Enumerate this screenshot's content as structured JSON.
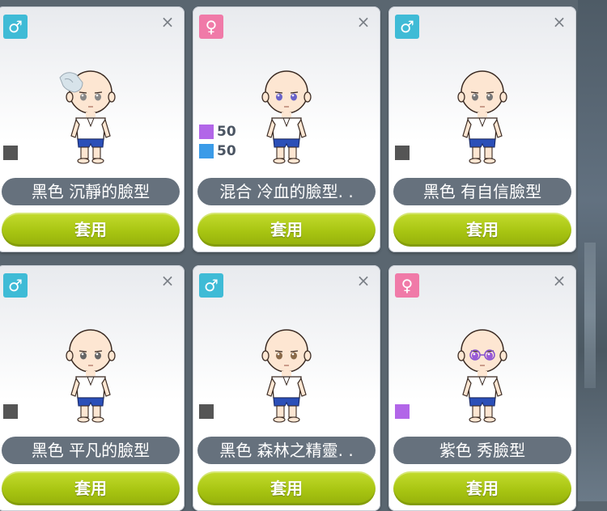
{
  "cards": [
    {
      "gender": "male",
      "gender_symbol": "♂",
      "swatches": [
        {
          "color": "#555555",
          "percent": ""
        }
      ],
      "name": "黑色  沉靜的臉型",
      "apply_label": "套用",
      "eye_color": "#888888",
      "special": "hand"
    },
    {
      "gender": "female",
      "gender_symbol": "♀",
      "swatches": [
        {
          "color": "#b266e8",
          "percent": "50"
        },
        {
          "color": "#3b9be8",
          "percent": "50"
        }
      ],
      "name": "混合  冷血的臉型. .",
      "apply_label": "套用",
      "eye_color": "#6a63c9",
      "special": ""
    },
    {
      "gender": "male",
      "gender_symbol": "♂",
      "swatches": [
        {
          "color": "#555555",
          "percent": ""
        }
      ],
      "name": "黑色  有自信臉型",
      "apply_label": "套用",
      "eye_color": "#777777",
      "special": ""
    },
    {
      "gender": "male",
      "gender_symbol": "♂",
      "swatches": [
        {
          "color": "#555555",
          "percent": ""
        }
      ],
      "name": "黑色  平凡的臉型",
      "apply_label": "套用",
      "eye_color": "#666666",
      "special": ""
    },
    {
      "gender": "male",
      "gender_symbol": "♂",
      "swatches": [
        {
          "color": "#555555",
          "percent": ""
        }
      ],
      "name": "黑色  森林之精靈. .",
      "apply_label": "套用",
      "eye_color": "#8a6a4a",
      "special": ""
    },
    {
      "gender": "female",
      "gender_symbol": "♀",
      "swatches": [
        {
          "color": "#b266e8",
          "percent": ""
        }
      ],
      "name": "紫色  秀臉型",
      "apply_label": "套用",
      "eye_color": "#9a5ad8",
      "special": "glasses"
    }
  ],
  "close_symbol": "×"
}
